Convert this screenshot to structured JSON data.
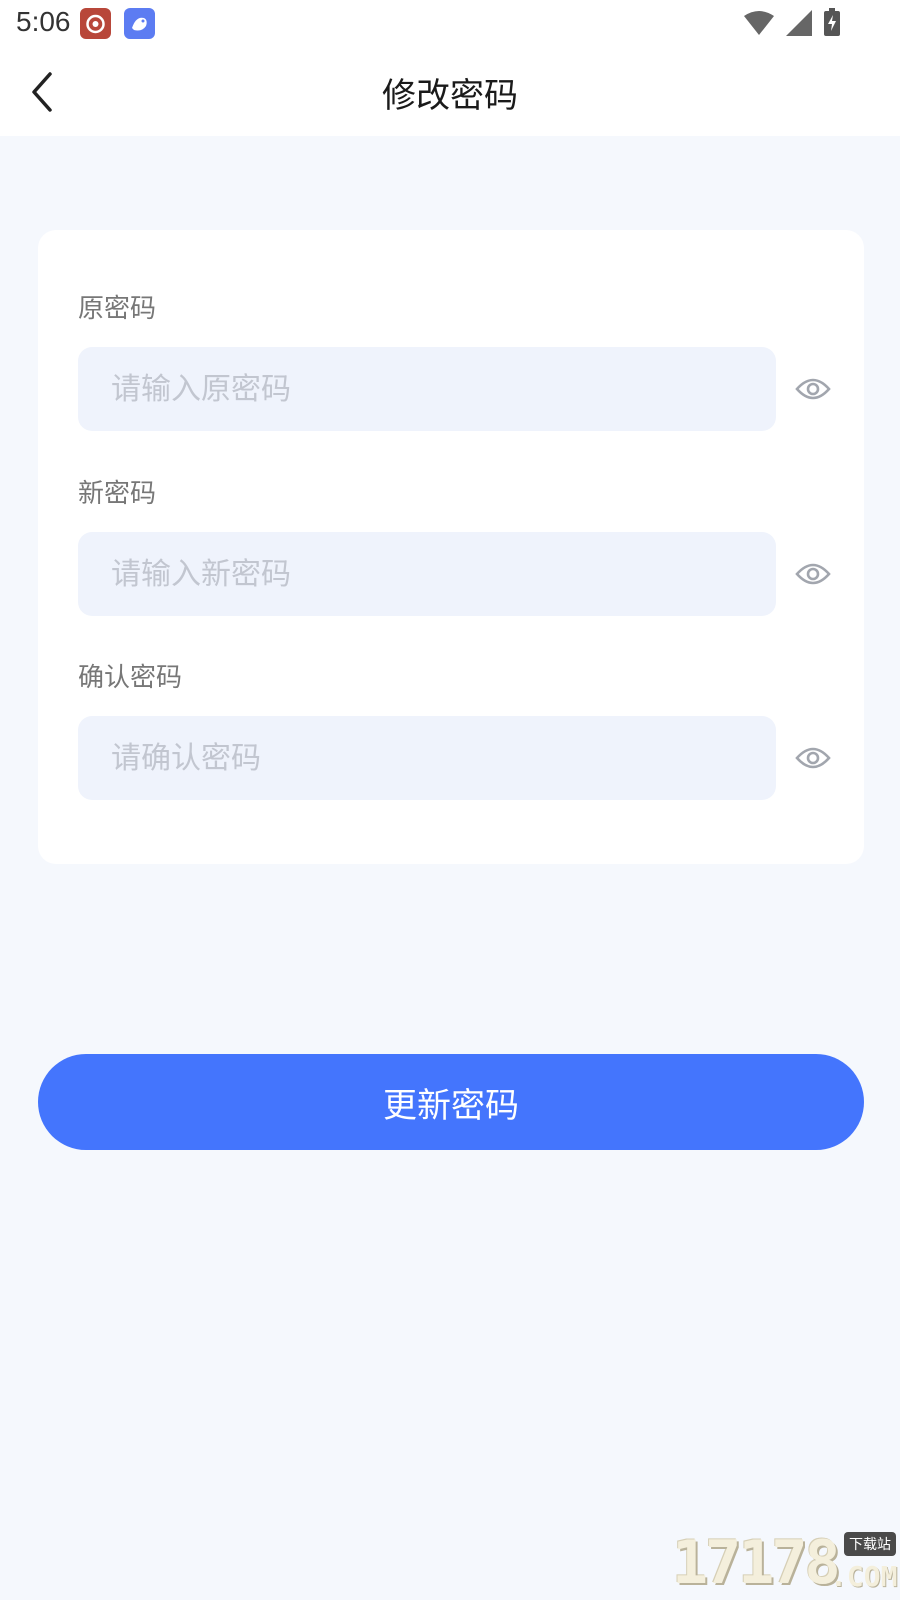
{
  "status_bar": {
    "time": "5:06"
  },
  "nav": {
    "title": "修改密码"
  },
  "form": {
    "fields": [
      {
        "label": "原密码",
        "placeholder": "请输入原密码",
        "value": ""
      },
      {
        "label": "新密码",
        "placeholder": "请输入新密码",
        "value": ""
      },
      {
        "label": "确认密码",
        "placeholder": "请确认密码",
        "value": ""
      }
    ]
  },
  "submit": {
    "label": "更新密码"
  },
  "watermark": {
    "number": "17178",
    "badge": "下载站",
    "suffix": ".COM"
  },
  "colors": {
    "primary": "#4475fd",
    "page_background": "#f5f8fd",
    "input_background": "#eff3fc"
  }
}
